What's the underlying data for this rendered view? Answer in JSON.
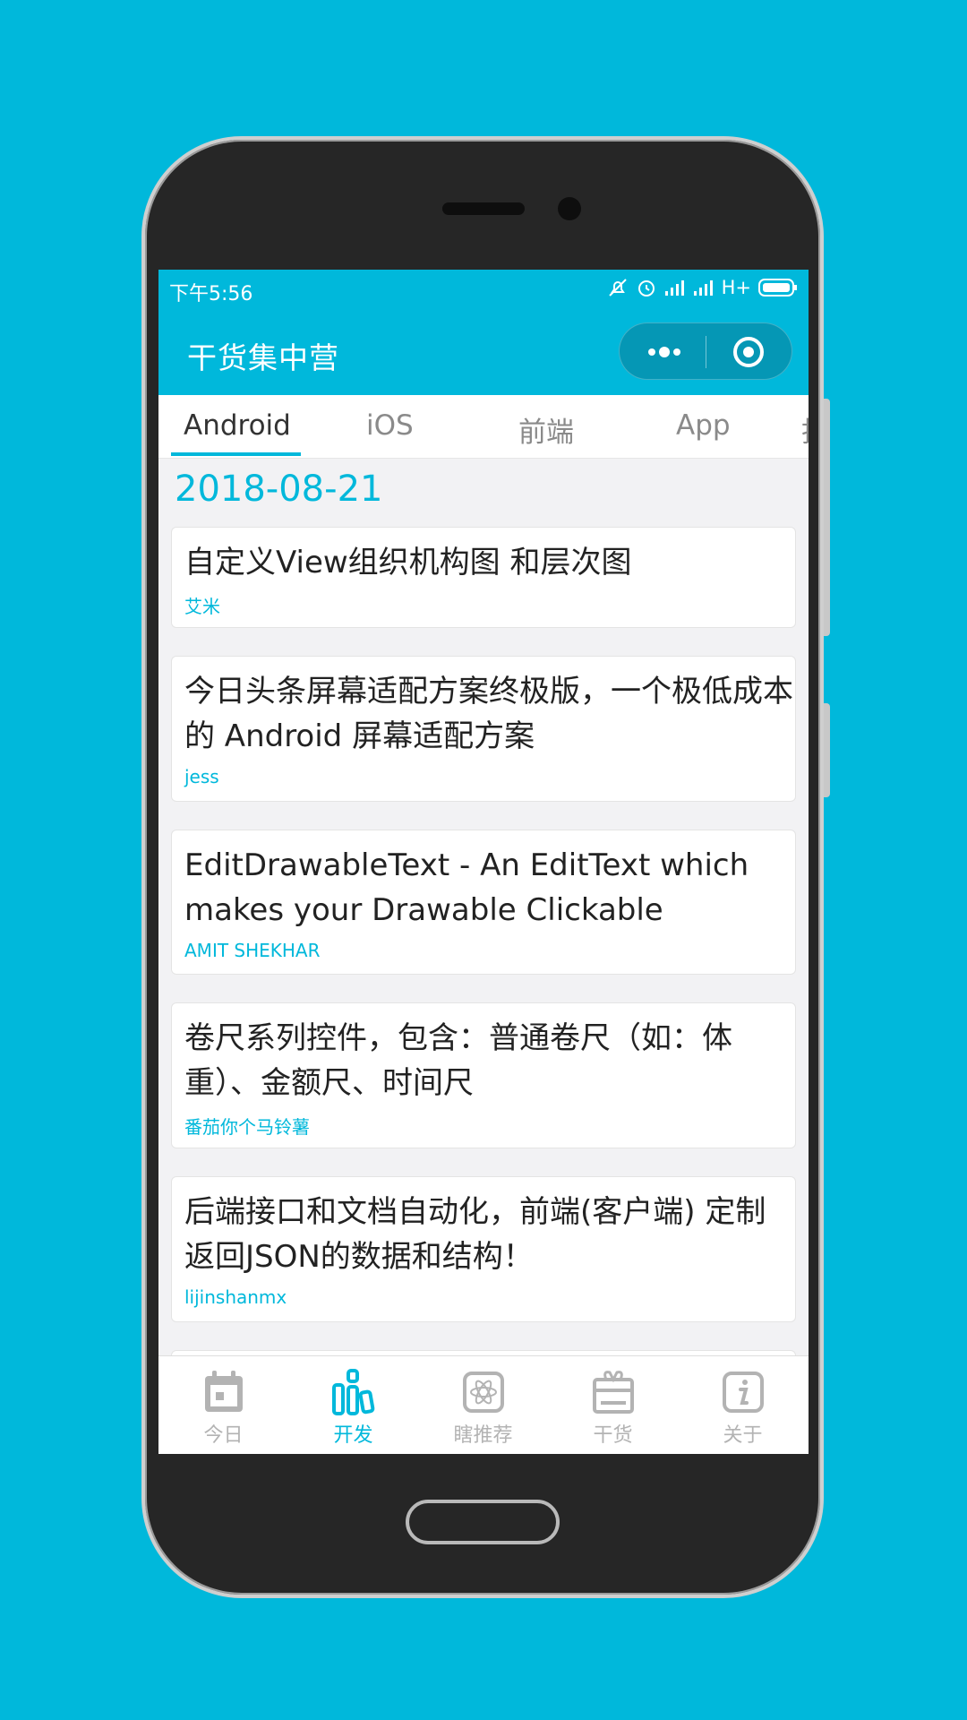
{
  "colors": {
    "accent": "#00b8db",
    "inactive": "#b3b3b3",
    "card_text": "#222222"
  },
  "status_bar": {
    "time": "下午5:56",
    "network": "H+",
    "icons": [
      "mute-icon",
      "alarm-icon",
      "signal-icon",
      "signal-icon",
      "battery-icon"
    ]
  },
  "nav_bar": {
    "title": "干货集中营",
    "more_icon": "more-dots-icon",
    "close_icon": "target-close-icon"
  },
  "tabs": [
    {
      "label": "Android",
      "active": true
    },
    {
      "label": "iOS",
      "active": false
    },
    {
      "label": "前端",
      "active": false
    },
    {
      "label": "App",
      "active": false
    },
    {
      "label": "拓",
      "active": false
    }
  ],
  "date": "2018-08-21",
  "articles": [
    {
      "title": "自定义View组织机构图 和层次图",
      "author": "艾米"
    },
    {
      "title": "今日头条屏幕适配方案终极版，一个极低成本的 Android 屏幕适配方案",
      "author": "jess"
    },
    {
      "title": "EditDrawableText - An EditText which makes your Drawable Clickable",
      "author": "AMIT SHEKHAR"
    },
    {
      "title": "卷尺系列控件，包含：普通卷尺（如：体重）、金额尺、时间尺",
      "author": "番茄你个马铃薯"
    },
    {
      "title": "后端接口和文档自动化，前端(客户端) 定制返回JSON的数据和结构！",
      "author": "lijinshanmx"
    }
  ],
  "tab_bar": [
    {
      "label": "今日",
      "icon": "calendar-icon",
      "active": false
    },
    {
      "label": "开发",
      "icon": "dev-bars-icon",
      "active": true
    },
    {
      "label": "瞎推荐",
      "icon": "atom-icon",
      "active": false
    },
    {
      "label": "干货",
      "icon": "gift-box-icon",
      "active": false
    },
    {
      "label": "关于",
      "icon": "info-icon",
      "active": false
    }
  ]
}
